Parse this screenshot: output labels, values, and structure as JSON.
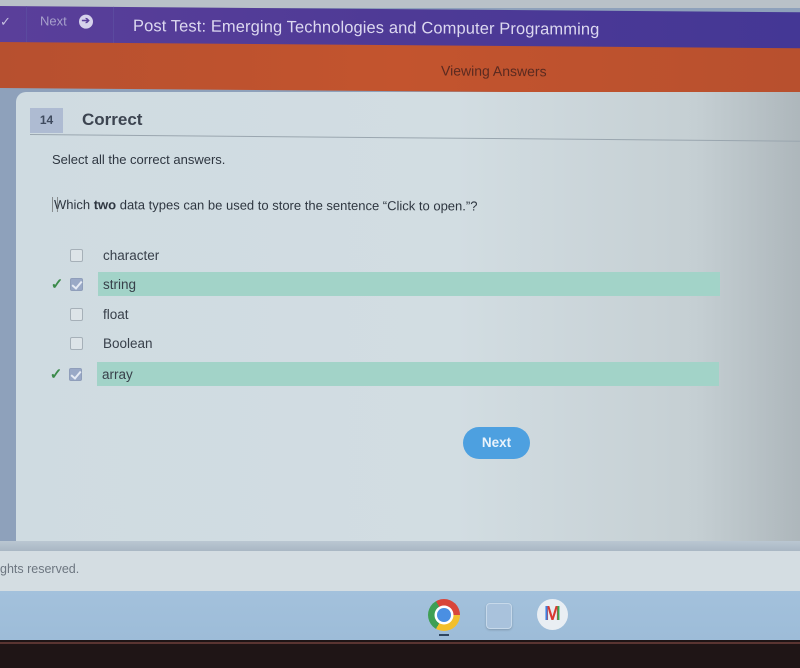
{
  "header": {
    "nav_check": "✓",
    "nav_next_label": "Next",
    "nav_next_icon": "arrow-right-circle-icon",
    "title": "Post Test: Emerging Technologies and Computer Programming"
  },
  "status_bar": {
    "label": "Viewing Answers"
  },
  "question": {
    "number": "14",
    "result": "Correct",
    "instruction": "Select all the correct answers.",
    "text_before": "Which ",
    "text_bold": "two",
    "text_after": " data types can be used to store the sentence “Click to open.”?",
    "answers": [
      {
        "label": "character",
        "checked": false,
        "correct": false
      },
      {
        "label": "string",
        "checked": true,
        "correct": true
      },
      {
        "label": "float",
        "checked": false,
        "correct": false
      },
      {
        "label": "Boolean",
        "checked": false,
        "correct": false
      },
      {
        "label": "array",
        "checked": true,
        "correct": true
      }
    ],
    "next_button": "Next"
  },
  "footer": {
    "text": "ghts reserved."
  },
  "taskbar": {
    "apps": [
      {
        "name": "Chrome",
        "icon": "chrome-icon",
        "active": true
      },
      {
        "name": "Files",
        "icon": "files-icon",
        "active": false
      },
      {
        "name": "Gmail",
        "icon": "gmail-icon",
        "glyph": "M",
        "active": false
      }
    ]
  },
  "colors": {
    "header_purple": "#4e3a96",
    "status_orange": "#c3542e",
    "correct_highlight": "#a2d3c8",
    "next_button_blue": "#4da0e0",
    "check_green": "#3b8a4a"
  }
}
